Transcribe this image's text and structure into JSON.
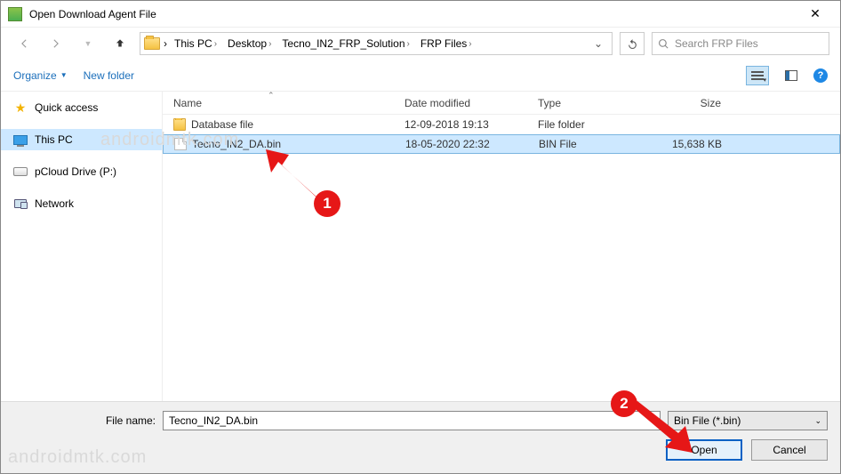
{
  "window": {
    "title": "Open Download Agent File"
  },
  "breadcrumb": {
    "items": [
      "This PC",
      "Desktop",
      "Tecno_IN2_FRP_Solution",
      "FRP Files"
    ]
  },
  "search": {
    "placeholder": "Search FRP Files"
  },
  "toolbar": {
    "organize": "Organize",
    "newfolder": "New folder"
  },
  "sidebar": {
    "items": [
      {
        "label": "Quick access",
        "icon": "star"
      },
      {
        "label": "This PC",
        "icon": "pc",
        "selected": true
      },
      {
        "label": "pCloud Drive (P:)",
        "icon": "drive"
      },
      {
        "label": "Network",
        "icon": "net"
      }
    ]
  },
  "columns": {
    "name": "Name",
    "date": "Date modified",
    "type": "Type",
    "size": "Size"
  },
  "files": [
    {
      "name": "Database file",
      "date": "12-09-2018 19:13",
      "type": "File folder",
      "size": "",
      "icon": "folder",
      "selected": false
    },
    {
      "name": "Tecno_IN2_DA.bin",
      "date": "18-05-2020 22:32",
      "type": "BIN File",
      "size": "15,638 KB",
      "icon": "doc",
      "selected": true
    }
  ],
  "footer": {
    "filename_label": "File name:",
    "filename_value": "Tecno_IN2_DA.bin",
    "filetype": "Bin File (*.bin)",
    "open": "Open",
    "cancel": "Cancel"
  },
  "annotations": {
    "one": "1",
    "two": "2"
  },
  "watermark": "androidmtk.com"
}
